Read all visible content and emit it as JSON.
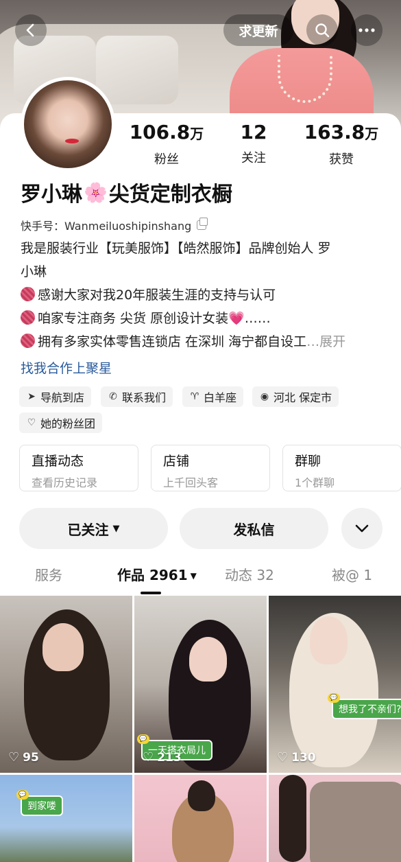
{
  "header": {
    "back_icon": "chevron-left-icon",
    "update_label": "求更新",
    "search_icon": "search-icon",
    "more_icon": "more-dots-icon"
  },
  "profile": {
    "stats": [
      {
        "value": "106.8",
        "unit": "万",
        "label": "粉丝"
      },
      {
        "value": "12",
        "unit": "",
        "label": "关注"
      },
      {
        "value": "163.8",
        "unit": "万",
        "label": "获赞"
      }
    ],
    "name_part1": "罗小琳",
    "name_emoji": "🌸",
    "name_part2": "尖货定制衣橱",
    "kuaishou_id": "快手号：Wanmeiluoshipinshang",
    "bio": {
      "line1": "我是服装行业【玩美服饰】【皓然服饰】品牌创始人 罗",
      "line2": "小琳",
      "line3": "感谢大家对我20年服装生涯的支持与认可",
      "line4": "咱家专注商务 尖货 原创设计女装",
      "line4_heart": "💗",
      "line4_tail": "……",
      "line5": "拥有多家实体零售连锁店 在深圳 海宁都自设工",
      "line5_ellipsis": "…",
      "expand": "展开"
    },
    "cooperate": "找我合作上聚星",
    "tags": [
      {
        "icon": "navigation-icon",
        "label": "导航到店"
      },
      {
        "icon": "phone-icon",
        "label": "联系我们"
      },
      {
        "icon": "zodiac-icon",
        "label": "白羊座"
      },
      {
        "icon": "location-icon",
        "label": "河北 保定市"
      },
      {
        "icon": "fan-club-icon",
        "label": "她的粉丝团"
      }
    ]
  },
  "entries": [
    {
      "title": "直播动态",
      "subtitle": "查看历史记录"
    },
    {
      "title": "店铺",
      "subtitle": "上千回头客"
    },
    {
      "title": "群聊",
      "subtitle": "1个群聊"
    }
  ],
  "actions": {
    "followed": "已关注",
    "message": "发私信",
    "expand_icon": "chevron-down-icon"
  },
  "tabs": [
    {
      "label": "服务"
    },
    {
      "label": "作品 2961"
    },
    {
      "label": "动态 32"
    },
    {
      "label": "被@ 1"
    }
  ],
  "grid": [
    {
      "likes": "95",
      "sticker": ""
    },
    {
      "likes": "213",
      "sticker": "一天搭衣局儿"
    },
    {
      "likes": "130",
      "sticker": "想我了不亲们?"
    },
    {
      "likes": "",
      "sticker": "到家喽"
    },
    {
      "likes": "",
      "sticker": ""
    },
    {
      "likes": "",
      "sticker": ""
    }
  ],
  "colors": {
    "link": "#2a5b9c",
    "sticker_green": "#49a64a",
    "tag_bg": "#f3f3f3"
  }
}
